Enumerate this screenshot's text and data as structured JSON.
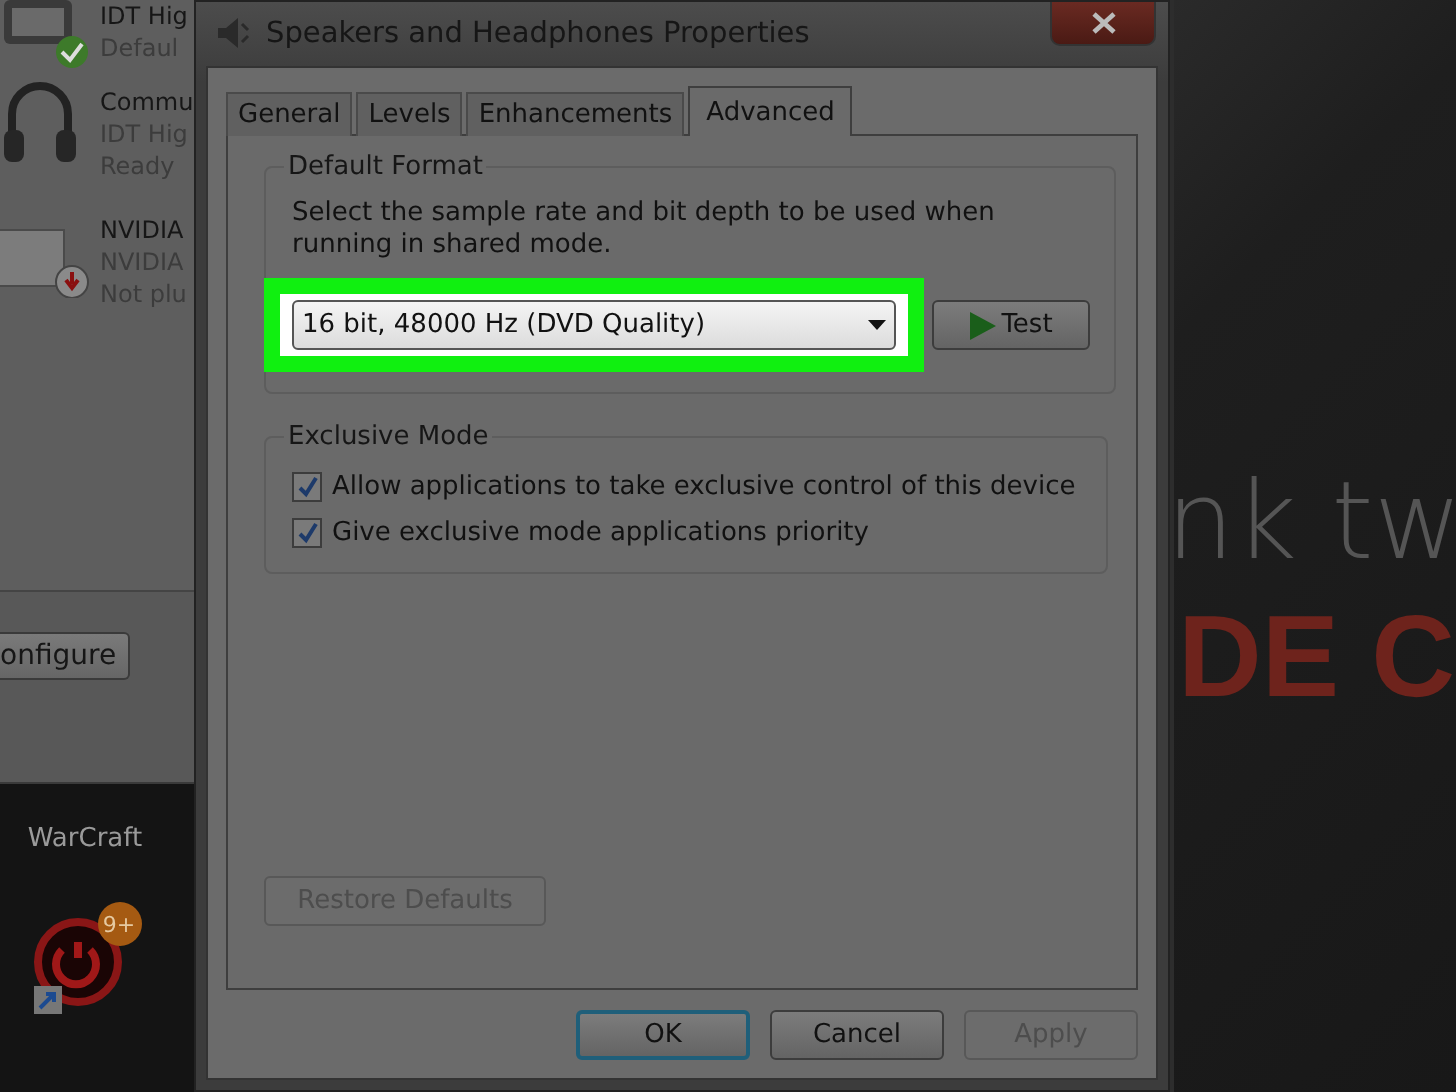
{
  "background_devices": [
    {
      "kind": "speaker",
      "is_default": true,
      "unplugged": false,
      "lines": [
        "IDT Hig",
        "Defaul"
      ]
    },
    {
      "kind": "headphones",
      "is_default": false,
      "unplugged": false,
      "lines": [
        "Commu",
        "IDT Hig",
        "Ready"
      ]
    },
    {
      "kind": "monitor",
      "is_default": false,
      "unplugged": true,
      "lines": [
        "NVIDIA",
        "NVIDIA",
        "Not plu"
      ]
    }
  ],
  "background_button": "onfigure",
  "desktop": {
    "label": "WarCraft",
    "badge": "9+"
  },
  "background_text": {
    "line_1": "nk tw",
    "line_2": "DE C"
  },
  "dialog": {
    "title": "Speakers and Headphones Properties",
    "tabs": [
      {
        "label": "General",
        "selected": false
      },
      {
        "label": "Levels",
        "selected": false
      },
      {
        "label": "Enhancements",
        "selected": false
      },
      {
        "label": "Advanced",
        "selected": true
      }
    ],
    "default_format": {
      "title": "Default Format",
      "description": "Select the sample rate and bit depth to be used when running in shared mode.",
      "value": "16 bit, 48000 Hz (DVD Quality)",
      "highlighted": true,
      "test_button": "Test"
    },
    "exclusive_mode": {
      "title": "Exclusive Mode",
      "options": [
        {
          "label": "Allow applications to take exclusive control of this device",
          "checked": true
        },
        {
          "label": "Give exclusive mode applications priority",
          "checked": true
        }
      ]
    },
    "restore_button": {
      "label": "Restore Defaults",
      "disabled": true
    },
    "buttons": [
      {
        "label": "OK",
        "default": true,
        "disabled": false
      },
      {
        "label": "Cancel",
        "default": false,
        "disabled": false
      },
      {
        "label": "Apply",
        "default": false,
        "disabled": true
      }
    ]
  }
}
